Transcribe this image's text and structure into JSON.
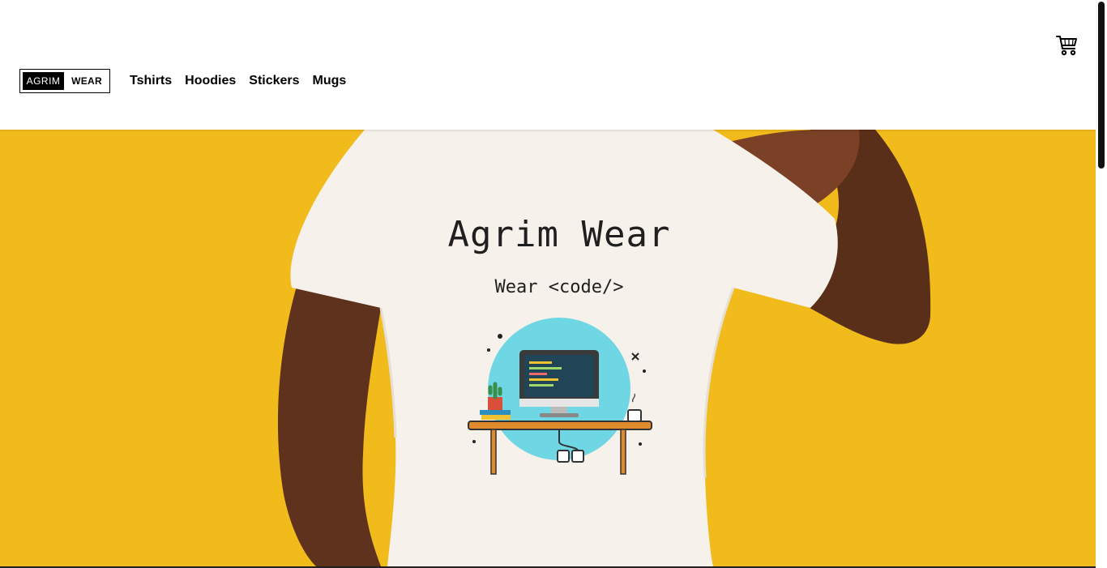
{
  "brand": {
    "logo_left": "AGRIM",
    "logo_right": "WEAR"
  },
  "nav": {
    "items": [
      {
        "label": "Tshirts"
      },
      {
        "label": "Hoodies"
      },
      {
        "label": "Stickers"
      },
      {
        "label": "Mugs"
      }
    ]
  },
  "header": {
    "cart_icon": "cart-icon"
  },
  "hero": {
    "shirt_title": "Agrim Wear",
    "shirt_subtitle": "Wear <code/>",
    "background_color": "#f2bb1c",
    "illustration": "computer-desk-illustration"
  }
}
